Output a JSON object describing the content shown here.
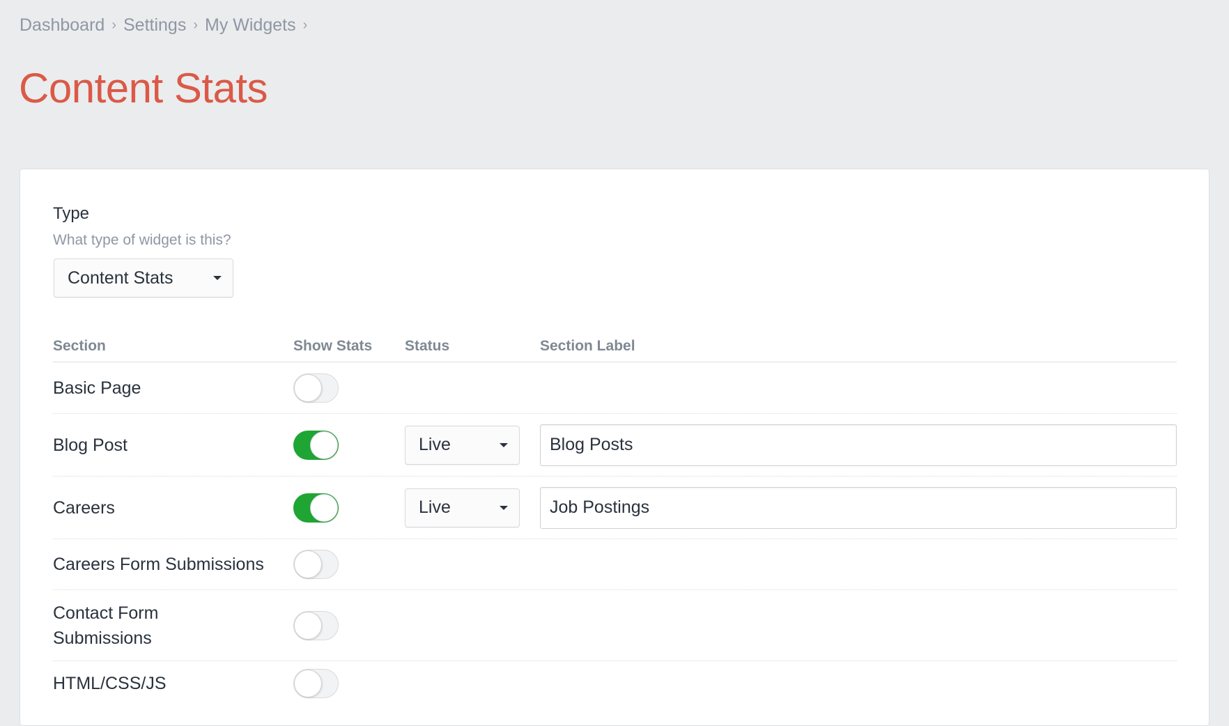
{
  "breadcrumb": [
    "Dashboard",
    "Settings",
    "My Widgets"
  ],
  "page_title": "Content Stats",
  "type_field": {
    "label": "Type",
    "help": "What type of widget is this?",
    "value": "Content Stats"
  },
  "table": {
    "headers": {
      "section": "Section",
      "show_stats": "Show Stats",
      "status": "Status",
      "section_label": "Section Label"
    },
    "rows": [
      {
        "section": "Basic Page",
        "show_stats": false
      },
      {
        "section": "Blog Post",
        "show_stats": true,
        "status": "Live",
        "section_label": "Blog Posts"
      },
      {
        "section": "Careers",
        "show_stats": true,
        "status": "Live",
        "section_label": "Job Postings"
      },
      {
        "section": "Careers Form Submissions",
        "show_stats": false
      },
      {
        "section": "Contact Form Submissions",
        "show_stats": false
      },
      {
        "section": "HTML/CSS/JS",
        "show_stats": false
      }
    ]
  },
  "colors": {
    "title": "#da5a47",
    "toggle_on": "#1fa533",
    "background": "#ebecee"
  }
}
